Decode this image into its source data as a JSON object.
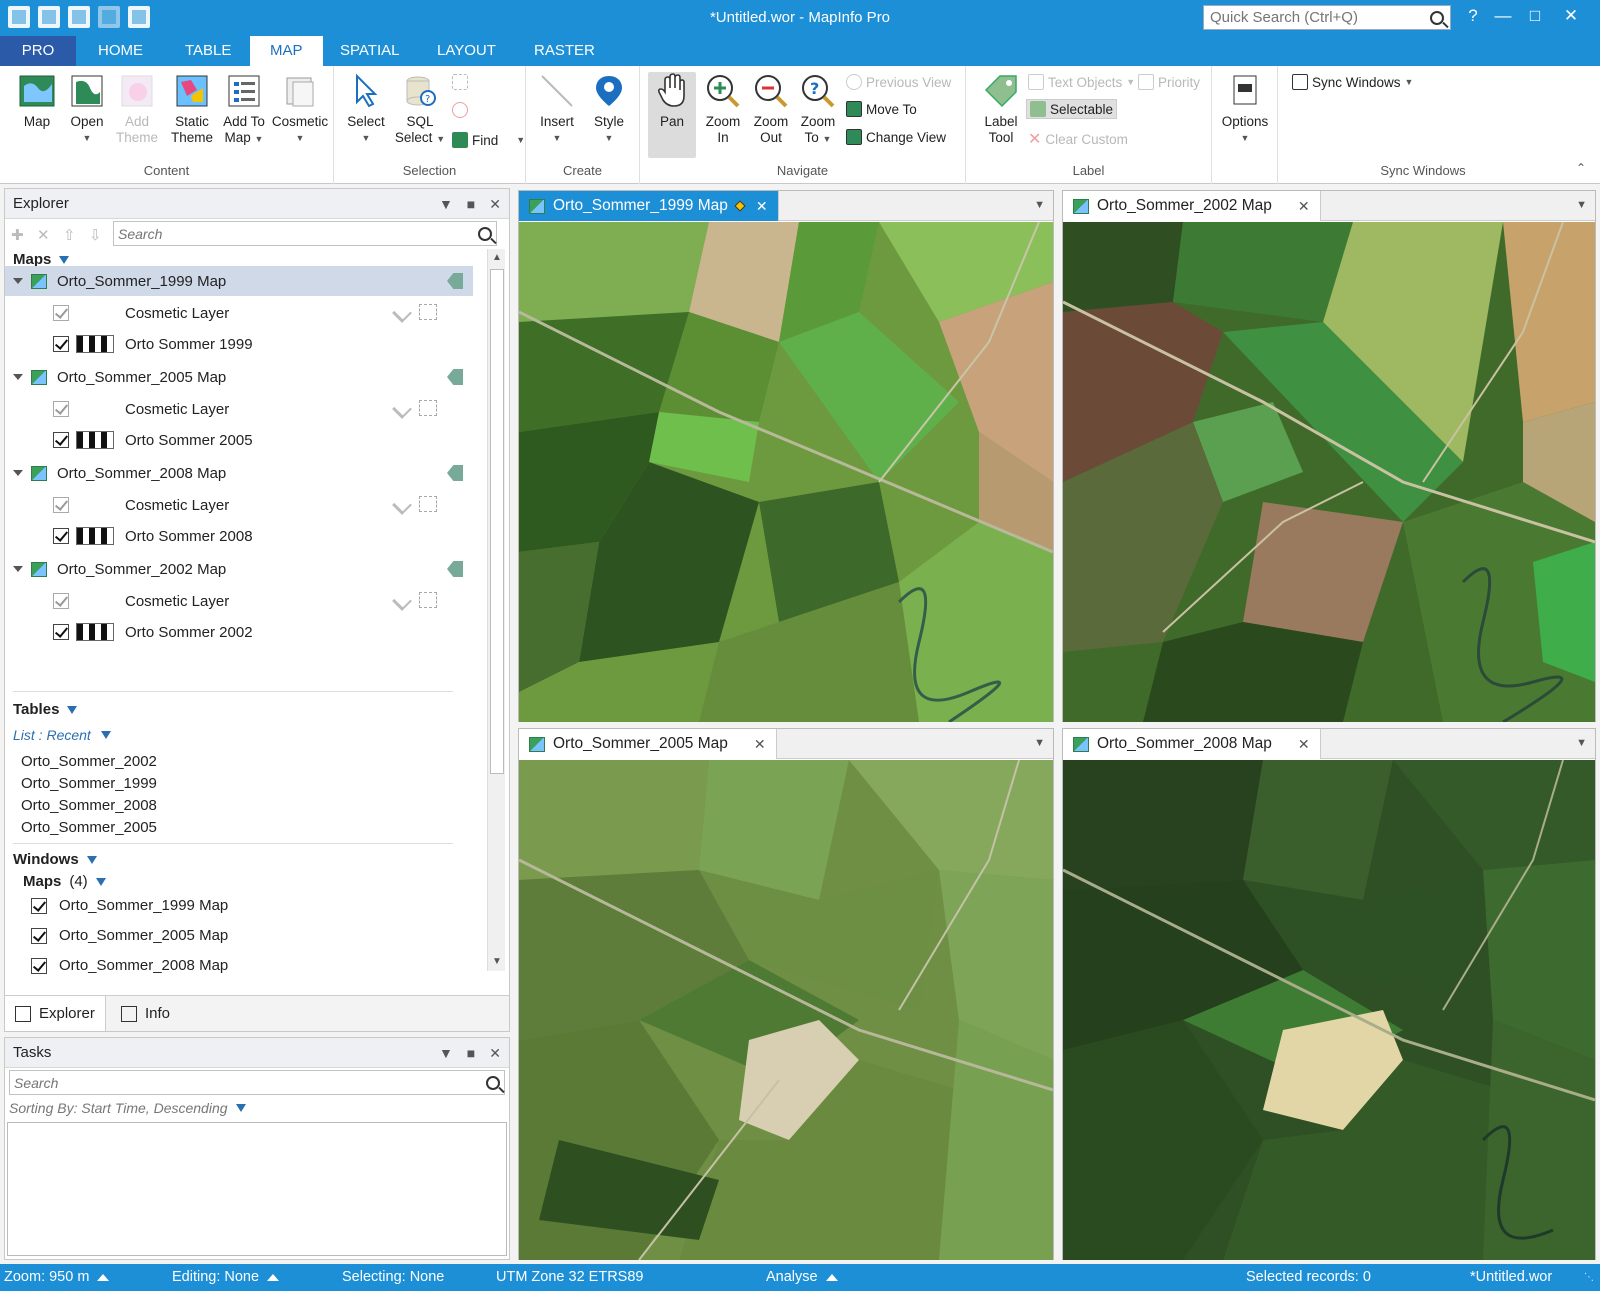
{
  "app": {
    "title": "*Untitled.wor - MapInfo Pro",
    "quick_search_placeholder": "Quick Search (Ctrl+Q)"
  },
  "ribbon_tabs": [
    "PRO",
    "HOME",
    "TABLE",
    "MAP",
    "SPATIAL",
    "LAYOUT",
    "RASTER"
  ],
  "ribbon": {
    "content": {
      "label": "Content",
      "map": "Map",
      "open": "Open",
      "add_theme_1": "Add",
      "add_theme_2": "Theme",
      "static_theme_1": "Static",
      "static_theme_2": "Theme",
      "add_to_map_1": "Add To",
      "add_to_map_2": "Map",
      "cosmetic": "Cosmetic"
    },
    "selection": {
      "label": "Selection",
      "select": "Select",
      "sql_select_1": "SQL",
      "sql_select_2": "Select",
      "find": "Find"
    },
    "create": {
      "label": "Create",
      "insert": "Insert",
      "style": "Style"
    },
    "navigate": {
      "label": "Navigate",
      "pan": "Pan",
      "zoom_in_1": "Zoom",
      "zoom_in_2": "In",
      "zoom_out_1": "Zoom",
      "zoom_out_2": "Out",
      "zoom_to_1": "Zoom",
      "zoom_to_2": "To",
      "previous_view": "Previous View",
      "move_to": "Move To",
      "change_view": "Change View"
    },
    "label_group": {
      "label": "Label",
      "label_tool_1": "Label",
      "label_tool_2": "Tool",
      "text_objects": "Text Objects",
      "priority": "Priority",
      "selectable": "Selectable",
      "clear_custom": "Clear Custom"
    },
    "options": {
      "label": "Options"
    },
    "sync": {
      "label": "Sync Windows",
      "sync_windows": "Sync Windows"
    }
  },
  "explorer": {
    "title": "Explorer",
    "search_placeholder": "Search",
    "maps_header": "Maps",
    "maps": [
      {
        "name": "Orto_Sommer_1999 Map",
        "cosmetic": "Cosmetic Layer",
        "raster": "Orto Sommer 1999"
      },
      {
        "name": "Orto_Sommer_2005 Map",
        "cosmetic": "Cosmetic Layer",
        "raster": "Orto Sommer 2005"
      },
      {
        "name": "Orto_Sommer_2008 Map",
        "cosmetic": "Cosmetic Layer",
        "raster": "Orto Sommer 2008"
      },
      {
        "name": "Orto_Sommer_2002 Map",
        "cosmetic": "Cosmetic Layer",
        "raster": "Orto Sommer 2002"
      }
    ],
    "tables_header": "Tables",
    "tables_list_mode": "List : Recent",
    "tables": [
      "Orto_Sommer_2002",
      "Orto_Sommer_1999",
      "Orto_Sommer_2008",
      "Orto_Sommer_2005"
    ],
    "windows_header": "Windows",
    "windows_maps_label": "Maps",
    "windows_maps_count": "(4)",
    "windows": [
      "Orto_Sommer_1999 Map",
      "Orto_Sommer_2005 Map",
      "Orto_Sommer_2008 Map"
    ],
    "tabs": {
      "explorer": "Explorer",
      "info": "Info"
    }
  },
  "tasks": {
    "title": "Tasks",
    "search_placeholder": "Search",
    "sorting": "Sorting By: Start Time, Descending"
  },
  "map_windows": [
    {
      "title": "Orto_Sommer_1999 Map"
    },
    {
      "title": "Orto_Sommer_2002 Map"
    },
    {
      "title": "Orto_Sommer_2005 Map"
    },
    {
      "title": "Orto_Sommer_2008 Map"
    }
  ],
  "statusbar": {
    "zoom": "Zoom: 950 m",
    "editing": "Editing: None",
    "selecting": "Selecting: None",
    "projection": "UTM Zone 32 ETRS89",
    "analyse": "Analyse",
    "selected": "Selected records: 0",
    "workspace": "*Untitled.wor"
  },
  "colors": {
    "accent": "#1c8fd6",
    "pro_tab": "#2a5aa8"
  }
}
